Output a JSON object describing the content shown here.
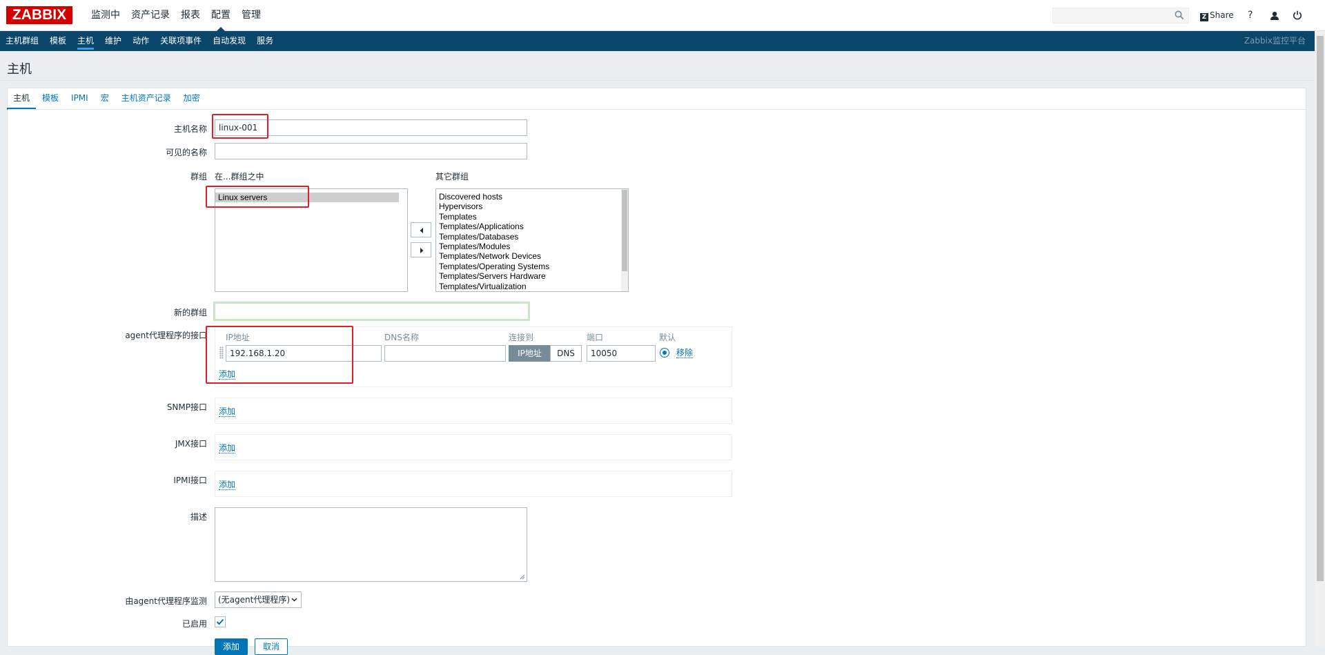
{
  "app": {
    "logo": "ZABBIX",
    "brand": "Zabbix监控平台"
  },
  "topmenu": [
    "监测中",
    "资产记录",
    "报表",
    "配置",
    "管理"
  ],
  "header_actions": {
    "share": "Share",
    "help": "?"
  },
  "search": {
    "value": "",
    "placeholder": ""
  },
  "subnav": [
    "主机群组",
    "模板",
    "主机",
    "维护",
    "动作",
    "关联项事件",
    "自动发现",
    "服务"
  ],
  "page_title": "主机",
  "tabs": [
    "主机",
    "模板",
    "IPMI",
    "宏",
    "主机资产记录",
    "加密"
  ],
  "form": {
    "host_name_label": "主机名称",
    "host_name_value": "linux-001",
    "visible_name_label": "可见的名称",
    "visible_name_value": "",
    "groups_label": "群组",
    "in_groups_label": "在...群组之中",
    "other_groups_label": "其它群组",
    "in_groups": [
      "Linux servers"
    ],
    "other_groups": [
      "Discovered hosts",
      "Hypervisors",
      "Templates",
      "Templates/Applications",
      "Templates/Databases",
      "Templates/Modules",
      "Templates/Network Devices",
      "Templates/Operating Systems",
      "Templates/Servers Hardware",
      "Templates/Virtualization"
    ],
    "new_group_label": "新的群组",
    "new_group_value": "",
    "agent_iface_label": "agent代理程序的接口",
    "iface_cols": {
      "ip": "IP地址",
      "dns": "DNS名称",
      "connect": "连接到",
      "port": "端口",
      "default": "默认"
    },
    "iface": {
      "ip": "192.168.1.20",
      "dns": "",
      "connect_ip": "IP地址",
      "connect_dns": "DNS",
      "port": "10050",
      "remove": "移除"
    },
    "add_link": "添加",
    "snmp_label": "SNMP接口",
    "jmx_label": "JMX接口",
    "ipmi_label": "IPMI接口",
    "description_label": "描述",
    "description_value": "",
    "proxy_label": "由agent代理程序监测",
    "proxy_value": "(无agent代理程序)",
    "enabled_label": "已启用",
    "add_button": "添加",
    "cancel_button": "取消"
  }
}
